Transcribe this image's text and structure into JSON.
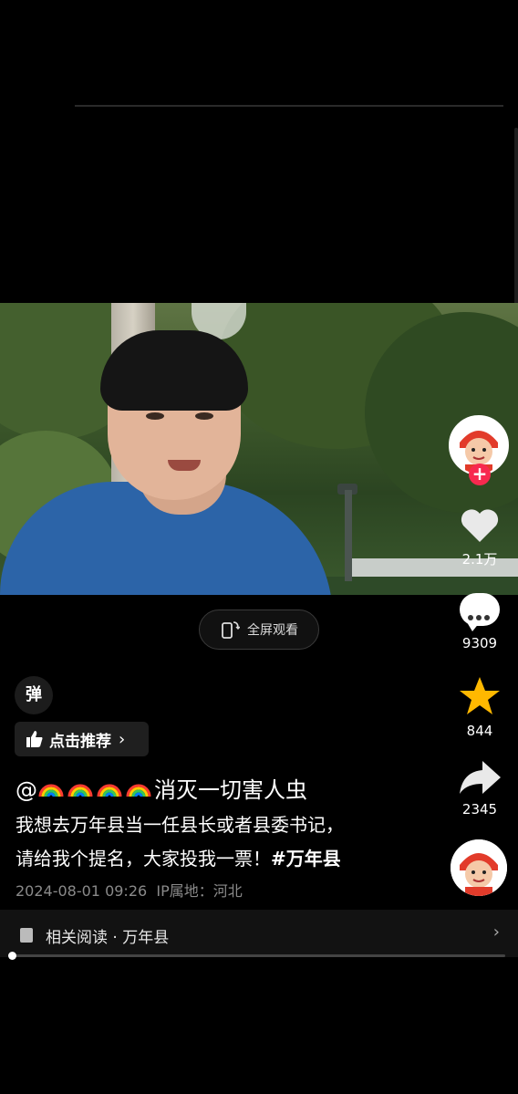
{
  "video": {
    "fullscreen_label": "全屏观看"
  },
  "actions": {
    "likes": "2.1万",
    "comments": "9309",
    "favorites": "844",
    "shares": "2345"
  },
  "danmaku_label": "弹",
  "recommend_label": "点击推荐",
  "post": {
    "author_prefix": "@",
    "author_emoji": [
      "rainbow",
      "rainbow",
      "rainbow",
      "rainbow"
    ],
    "author_name": "消灭一切害人虫",
    "description_line1": "我想去万年县当一任县长或者县委书记，",
    "description_line2": "请给我个提名，大家投我一票！",
    "hashtag": "#万年县",
    "date": "2024-08-01 09:26",
    "ip_location": "IP属地：河北"
  },
  "related": {
    "label": "相关阅读 · 万年县"
  },
  "playback": {
    "progress_fraction": 0.005
  },
  "colors": {
    "follow_plus": "#f7294f",
    "favorite_star": "#ffb800",
    "background": "#000000"
  }
}
